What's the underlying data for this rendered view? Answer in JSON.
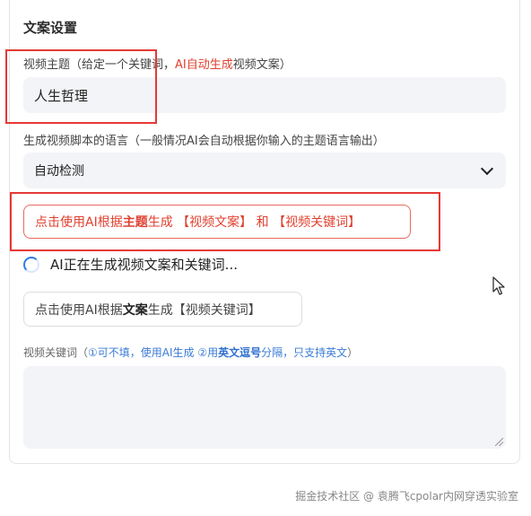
{
  "section": {
    "title": "文案设置"
  },
  "topic": {
    "label_prefix": "视频主题（给定一个关键词，",
    "label_highlight": "AI自动生成",
    "label_suffix": "视频文案）",
    "value": "人生哲理"
  },
  "language": {
    "label": "生成视频脚本的语言（一般情况AI会自动根据你输入的主题语言输出）",
    "selected": "自动检测"
  },
  "generate_from_topic": {
    "prefix": "点击使用AI根据",
    "bold": "主题",
    "suffix": "生成 【视频文案】 和 【视频关键词】"
  },
  "status": {
    "loading_text": "AI正在生成视频文案和关键词..."
  },
  "generate_from_script": {
    "prefix": "点击使用AI根据",
    "bold": "文案",
    "suffix": "生成【视频关键词】"
  },
  "keywords": {
    "label_prefix": "视频关键词（",
    "label_blue1": "①可不填，使用AI生成 ②用",
    "label_bold": "英文逗号",
    "label_blue2": "分隔，只支持英文",
    "label_suffix": "）",
    "value": ""
  },
  "watermark": "掘金技术社区 @ 袁腾飞cpolar内网穿透实验室",
  "colors": {
    "highlight_red": "#e53935",
    "link_blue": "#3a7bd5",
    "spinner_blue": "#2f7ae5"
  }
}
